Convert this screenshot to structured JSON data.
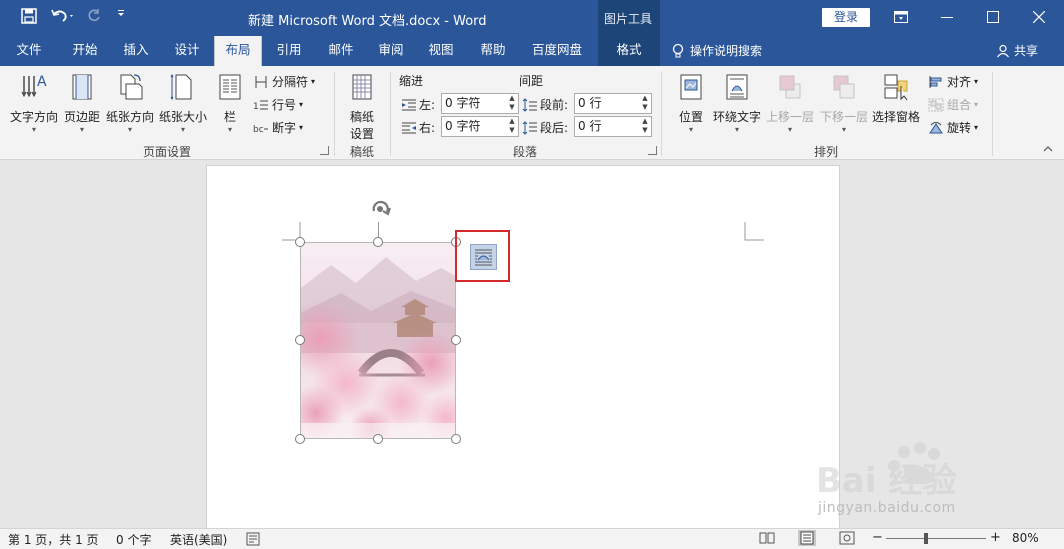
{
  "title_bar": {
    "doc_title": "新建 Microsoft Word 文档.docx  -  Word",
    "picture_tools": "图片工具",
    "login": "登录"
  },
  "tabs": [
    "文件",
    "开始",
    "插入",
    "设计",
    "布局",
    "引用",
    "邮件",
    "审阅",
    "视图",
    "帮助",
    "百度网盘",
    "格式"
  ],
  "active_tab": "布局",
  "search_label": "操作说明搜索",
  "share_label": "共享",
  "ribbon": {
    "page_setup": {
      "text_direction": "文字方向",
      "margins": "页边距",
      "orientation": "纸张方向",
      "size": "纸张大小",
      "columns": "栏",
      "breaks": "分隔符",
      "line_numbers": "行号",
      "hyphenation": "断字",
      "group_label": "页面设置"
    },
    "manuscript": {
      "button_line1": "稿纸",
      "button_line2": "设置",
      "group_label": "稿纸"
    },
    "paragraph": {
      "indent_title": "缩进",
      "spacing_title": "间距",
      "left_label": "左:",
      "left_value": "0 字符",
      "right_label": "右:",
      "right_value": "0 字符",
      "before_label": "段前:",
      "before_value": "0 行",
      "after_label": "段后:",
      "after_value": "0 行",
      "group_label": "段落"
    },
    "arrange": {
      "position": "位置",
      "wrap_text": "环绕文字",
      "bring_forward": "上移一层",
      "send_backward": "下移一层",
      "selection_pane": "选择窗格",
      "align": "对齐",
      "group": "组合",
      "rotate": "旋转",
      "group_label": "排列"
    }
  },
  "status_bar": {
    "page": "第 1 页，共 1 页",
    "words": "0 个字",
    "language": "英语(美国)",
    "zoom_minus": "−",
    "zoom_plus": "+",
    "zoom": "80%"
  },
  "watermark": {
    "brand": "Bai  经验",
    "url": "jingyan.baidu.com"
  },
  "colors": {
    "title_bar": "#2b579a",
    "contextual_tab": "#1e4577",
    "highlight": "#d22a2a"
  }
}
